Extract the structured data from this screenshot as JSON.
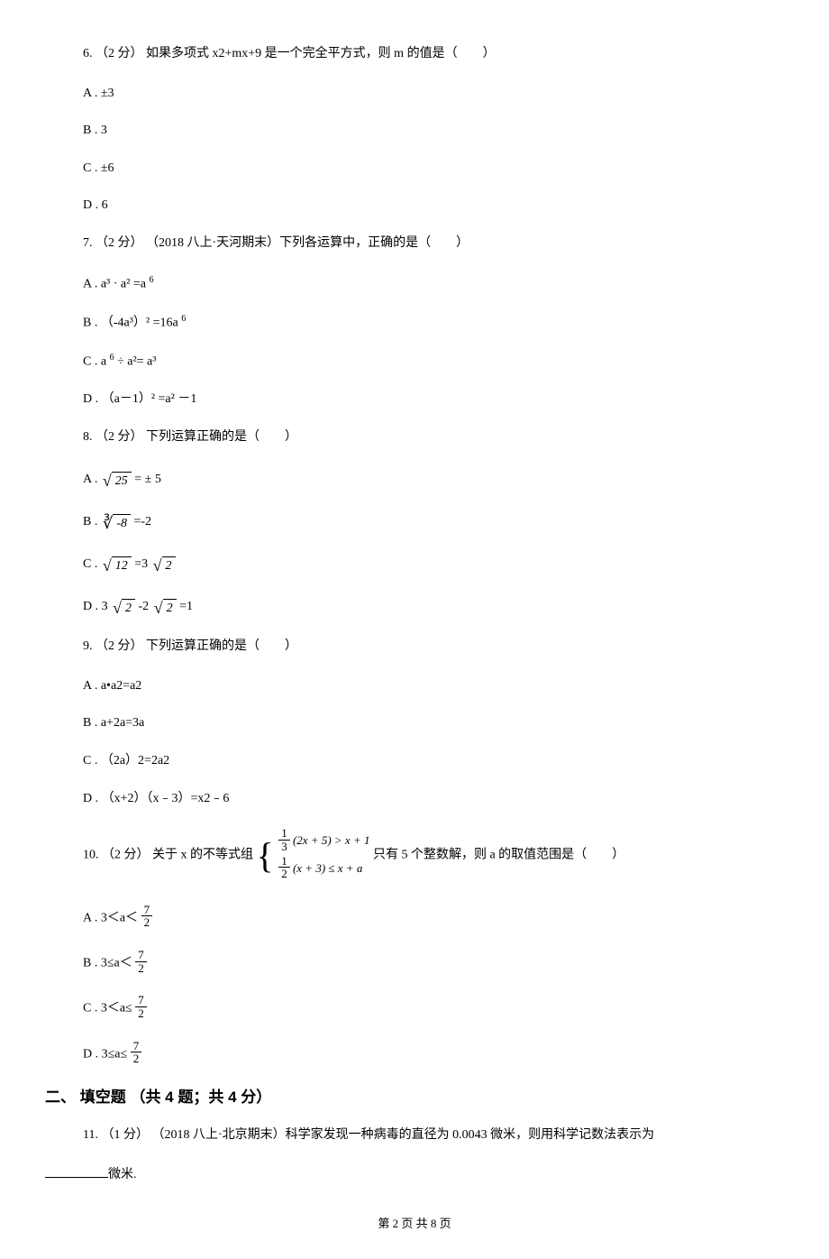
{
  "q6": {
    "text": "6. （2 分） 如果多项式 x2+mx+9 是一个完全平方式，则 m 的值是（　　）",
    "A": "A . ±3",
    "B": "B . 3",
    "C": "C . ±6",
    "D": "D . 6"
  },
  "q7": {
    "text": "7. （2 分） （2018 八上·天河期末）下列各运算中，正确的是（　　）",
    "A_pre": "A . a³ · a² =a ",
    "A_sup": "6",
    "B_pre": "B . （-4a³）² =16a ",
    "B_sup": "6",
    "C_pre": "C . a ",
    "C_sup": "6",
    "C_post": " ÷ a²= a³",
    "D": "D . （a－1）² =a² －1"
  },
  "q8": {
    "text": "8. （2 分） 下列运算正确的是（　　）",
    "A_pre": "A . ",
    "A_rad": "25",
    "A_post": " = ± 5",
    "B_pre": "B . ",
    "B_rad": "-8",
    "B_post": " =-2",
    "C_pre": "C . ",
    "C_rad": "12",
    "C_mid": " =3",
    "C_rad2": "2",
    "D_pre": "D . 3",
    "D_rad1": "2",
    "D_mid": " -2",
    "D_rad2": "2",
    "D_post": " =1"
  },
  "q9": {
    "text": "9. （2 分） 下列运算正确的是（　　）",
    "A": "A . a•a2=a2",
    "B": "B . a+2a=3a",
    "C": "C . （2a）2=2a2",
    "D": "D . （x+2）（x﹣3）=x2﹣6"
  },
  "q10": {
    "pre": "10. （2 分） 关于 x 的不等式组 ",
    "line1_pre": "(2x + 5) > x + 1",
    "line2_pre": "(x + 3) ≤ x + a",
    "frac1_n": "1",
    "frac1_d": "3",
    "frac2_n": "1",
    "frac2_d": "2",
    "post": " 只有 5 个整数解，则 a 的取值范围是（　　）",
    "A_pre": "A . 3＜a＜ ",
    "B_pre": "B . 3≤a＜ ",
    "C_pre": "C . 3＜a≤ ",
    "D_pre": "D . 3≤a≤ ",
    "frac_n": "7",
    "frac_d": "2"
  },
  "section2": "二、 填空题 （共 4 题；共 4 分）",
  "q11": {
    "text": "11. （1 分） （2018 八上·北京期末）科学家发现一种病毒的直径为 0.0043 微米，则用科学记数法表示为",
    "unit": "微米."
  },
  "footer": "第 2 页 共 8 页",
  "chart_data": {
    "type": "table",
    "note": "Mathematics exam questions page 2 of 8",
    "questions": [
      {
        "num": 6,
        "points": 2,
        "type": "multiple_choice",
        "options": [
          "±3",
          "3",
          "±6",
          "6"
        ]
      },
      {
        "num": 7,
        "points": 2,
        "type": "multiple_choice",
        "source": "2018八上·天河期末",
        "options": [
          "a³·a²=a⁶",
          "(-4a³)²=16a⁶",
          "a⁶÷a²=a³",
          "(a-1)²=a²-1"
        ]
      },
      {
        "num": 8,
        "points": 2,
        "type": "multiple_choice",
        "options": [
          "√25=±5",
          "∛(-8)=-2",
          "√12=3√2",
          "3√2-2√2=1"
        ]
      },
      {
        "num": 9,
        "points": 2,
        "type": "multiple_choice",
        "options": [
          "a·a2=a2",
          "a+2a=3a",
          "(2a)2=2a2",
          "(x+2)(x-3)=x2-6"
        ]
      },
      {
        "num": 10,
        "points": 2,
        "type": "multiple_choice",
        "system": "(1/3)(2x+5)>x+1 ; (1/2)(x+3)≤x+a",
        "options": [
          "3<a<7/2",
          "3≤a<7/2",
          "3<a≤7/2",
          "3≤a≤7/2"
        ]
      },
      {
        "num": 11,
        "points": 1,
        "type": "fill_blank",
        "source": "2018八上·北京期末",
        "value": "0.0043 微米"
      }
    ]
  }
}
